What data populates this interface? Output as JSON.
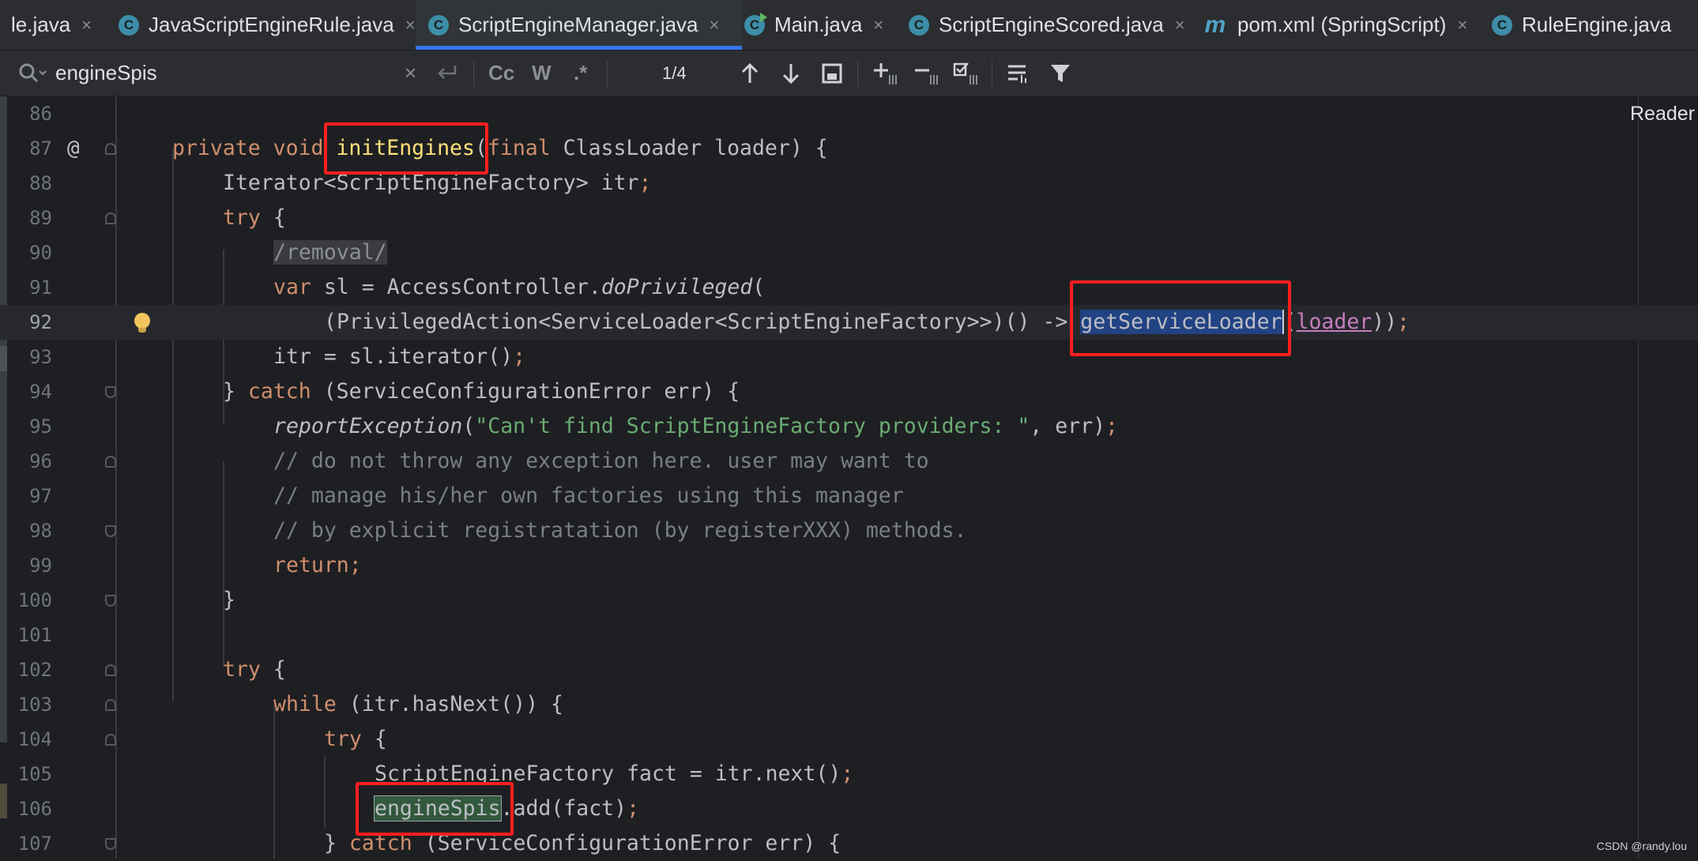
{
  "tabs": [
    {
      "label": "le.java",
      "icon": "none",
      "active": false
    },
    {
      "label": "JavaScriptEngineRule.java",
      "icon": "class-icon",
      "active": false
    },
    {
      "label": "ScriptEngineManager.java",
      "icon": "class-icon",
      "active": true
    },
    {
      "label": "Main.java",
      "icon": "runnable-class-icon",
      "active": false
    },
    {
      "label": "ScriptEngineScored.java",
      "icon": "class-icon",
      "active": false
    },
    {
      "label": "pom.xml (SpringScript)",
      "icon": "maven-icon",
      "active": false
    },
    {
      "label": "RuleEngine.java",
      "icon": "class-icon",
      "active": false
    }
  ],
  "tab_close_glyph": "×",
  "class_icon_glyph": "C",
  "maven_icon_glyph": "m",
  "search": {
    "query": "engineSpis",
    "match_count": "1/4",
    "match_case_label": "Cc",
    "words_label": "W",
    "regex_label": ".*"
  },
  "reader_mode_label": "Reader",
  "colors": {
    "background": "#1e1f22",
    "keyword": "#cf8e6d",
    "string": "#6aab73",
    "comment": "#7a7e85",
    "annotation_box": "#ff1f1f",
    "tab_underline": "#3574f0"
  },
  "code_lines": [
    {
      "number": "86",
      "text": ""
    },
    {
      "number": "87",
      "text": "private void initEngines(final ClassLoader loader) {"
    },
    {
      "number": "88",
      "text": "Iterator<ScriptEngineFactory> itr;"
    },
    {
      "number": "89",
      "text": "try {"
    },
    {
      "number": "90",
      "text": "/removal/"
    },
    {
      "number": "91",
      "text": "var sl = AccessController.doPrivileged("
    },
    {
      "number": "92",
      "text": "(PrivilegedAction<ServiceLoader<ScriptEngineFactory>>)() -> getServiceLoader(loader));"
    },
    {
      "number": "93",
      "text": "itr = sl.iterator();"
    },
    {
      "number": "94",
      "text": "} catch (ServiceConfigurationError err) {"
    },
    {
      "number": "95",
      "text": "reportException(\"Can't find ScriptEngineFactory providers: \", err);"
    },
    {
      "number": "96",
      "text": "// do not throw any exception here. user may want to"
    },
    {
      "number": "97",
      "text": "// manage his/her own factories using this manager"
    },
    {
      "number": "98",
      "text": "// by explicit registratation (by registerXXX) methods."
    },
    {
      "number": "99",
      "text": "return;"
    },
    {
      "number": "100",
      "text": "}"
    },
    {
      "number": "101",
      "text": ""
    },
    {
      "number": "102",
      "text": "try {"
    },
    {
      "number": "103",
      "text": "while (itr.hasNext()) {"
    },
    {
      "number": "104",
      "text": "try {"
    },
    {
      "number": "105",
      "text": "ScriptEngineFactory fact = itr.next();"
    },
    {
      "number": "106",
      "text": "engineSpis.add(fact);"
    },
    {
      "number": "107",
      "text": "} catch (ServiceConfigurationError err) {"
    }
  ],
  "tokens": {
    "l87": {
      "private": "private",
      "void": "void",
      "method": "initEngines",
      "paren": "(",
      "final": "final",
      "rest": " ClassLoader loader) {"
    },
    "l88": {
      "a": "Iterator<ScriptEngineFactory> itr",
      "semi": ";"
    },
    "l89": {
      "try": "try",
      "rest": " {"
    },
    "l90": {
      "removal": "/removal/"
    },
    "l91": {
      "var": "var",
      "a": " sl = AccessController.",
      "call": "doPrivileged",
      "b": "("
    },
    "l92": {
      "a": "(PrivilegedAction<ServiceLoader<ScriptEngineFactory>>)() -> ",
      "ident": "getServiceLoader",
      "b": "(",
      "param": "loader",
      "c": "))",
      "semi": ";"
    },
    "l93": {
      "a": "itr = sl.iterator()",
      "semi": ";"
    },
    "l94": {
      "a": "} ",
      "catch": "catch",
      "b": " (ServiceConfigurationError err) {"
    },
    "l95": {
      "call": "reportException",
      "a": "(",
      "str": "\"Can't find ScriptEngineFactory providers: \"",
      "b": ", err)",
      "semi": ";"
    },
    "l99": {
      "ret": "return",
      "semi": ";"
    },
    "l103": {
      "while": "while",
      "rest": " (itr.hasNext()) {"
    },
    "l105": {
      "a": "ScriptEngineFactory fact = itr.next()",
      "semi": ";"
    },
    "l106": {
      "match": "engineSpis",
      "a": ".add(fact)",
      "semi": ";"
    },
    "l107": {
      "a": "} ",
      "catch": "catch",
      "b": " (ServiceConfigurationError err) {"
    }
  },
  "gutter": {
    "override_marker": "@"
  },
  "watermark": "CSDN @randy.lou"
}
